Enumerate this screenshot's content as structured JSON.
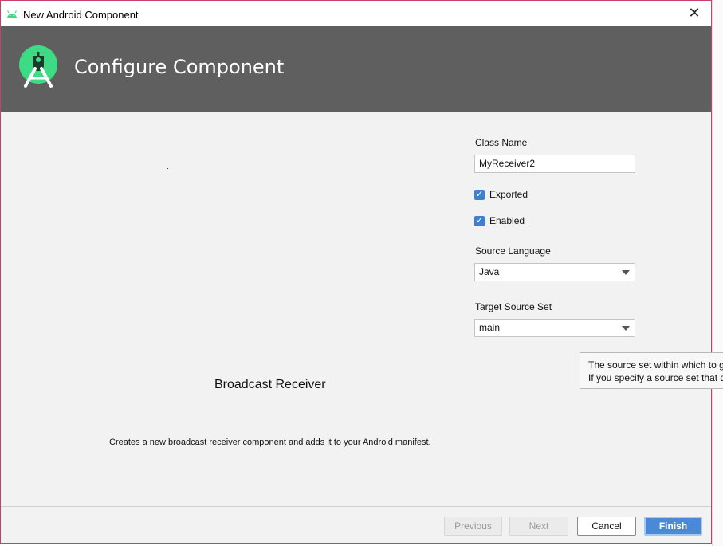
{
  "window": {
    "title": "New Android Component",
    "close_glyph": "✕",
    "icon": "android-icon"
  },
  "header": {
    "title": "Configure Component",
    "logo": "android-studio-logo"
  },
  "preview": {
    "component_name": "Broadcast Receiver",
    "description": "Creates a new broadcast receiver component and adds it to your Android manifest."
  },
  "form": {
    "class_name_label": "Class Name",
    "class_name_value": "MyReceiver2",
    "exported_label": "Exported",
    "exported_checked": true,
    "enabled_label": "Enabled",
    "enabled_checked": true,
    "source_language_label": "Source Language",
    "source_language_value": "Java",
    "target_source_set_label": "Target Source Set",
    "target_source_set_value": "main"
  },
  "tooltip": {
    "line1": "The source set within which to g",
    "line2": "If you specify a source set that d"
  },
  "footer": {
    "previous_label": "Previous",
    "next_label": "Next",
    "cancel_label": "Cancel",
    "finish_label": "Finish"
  },
  "colors": {
    "header_bg": "#5f5f5f",
    "accent": "#4a89d8",
    "android_green": "#3ddc84"
  }
}
